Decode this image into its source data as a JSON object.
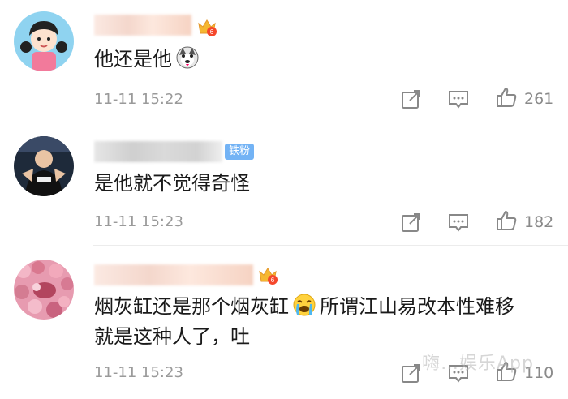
{
  "comments": [
    {
      "text": "他还是他",
      "emoji": "dog-face-emoji",
      "time": "11-11 15:22",
      "likes": "261",
      "badge": "vip-crown"
    },
    {
      "text": "是他就不觉得奇怪",
      "time": "11-11 15:23",
      "likes": "182",
      "badge": "铁粉"
    },
    {
      "text_line1_a": "烟灰缸还是那个烟灰缸",
      "text_line1_b": "所谓江山易改本性难移",
      "text_line2": "就是这种人了，吐",
      "emoji": "crying-face-emoji",
      "time": "11-11 15:23",
      "likes": "110",
      "badge": "vip-crown"
    }
  ],
  "watermark": "嗨…娱乐App",
  "colors": {
    "fan_badge": "#73b3f5",
    "time": "#9a9a9a",
    "divider": "#ececec"
  }
}
